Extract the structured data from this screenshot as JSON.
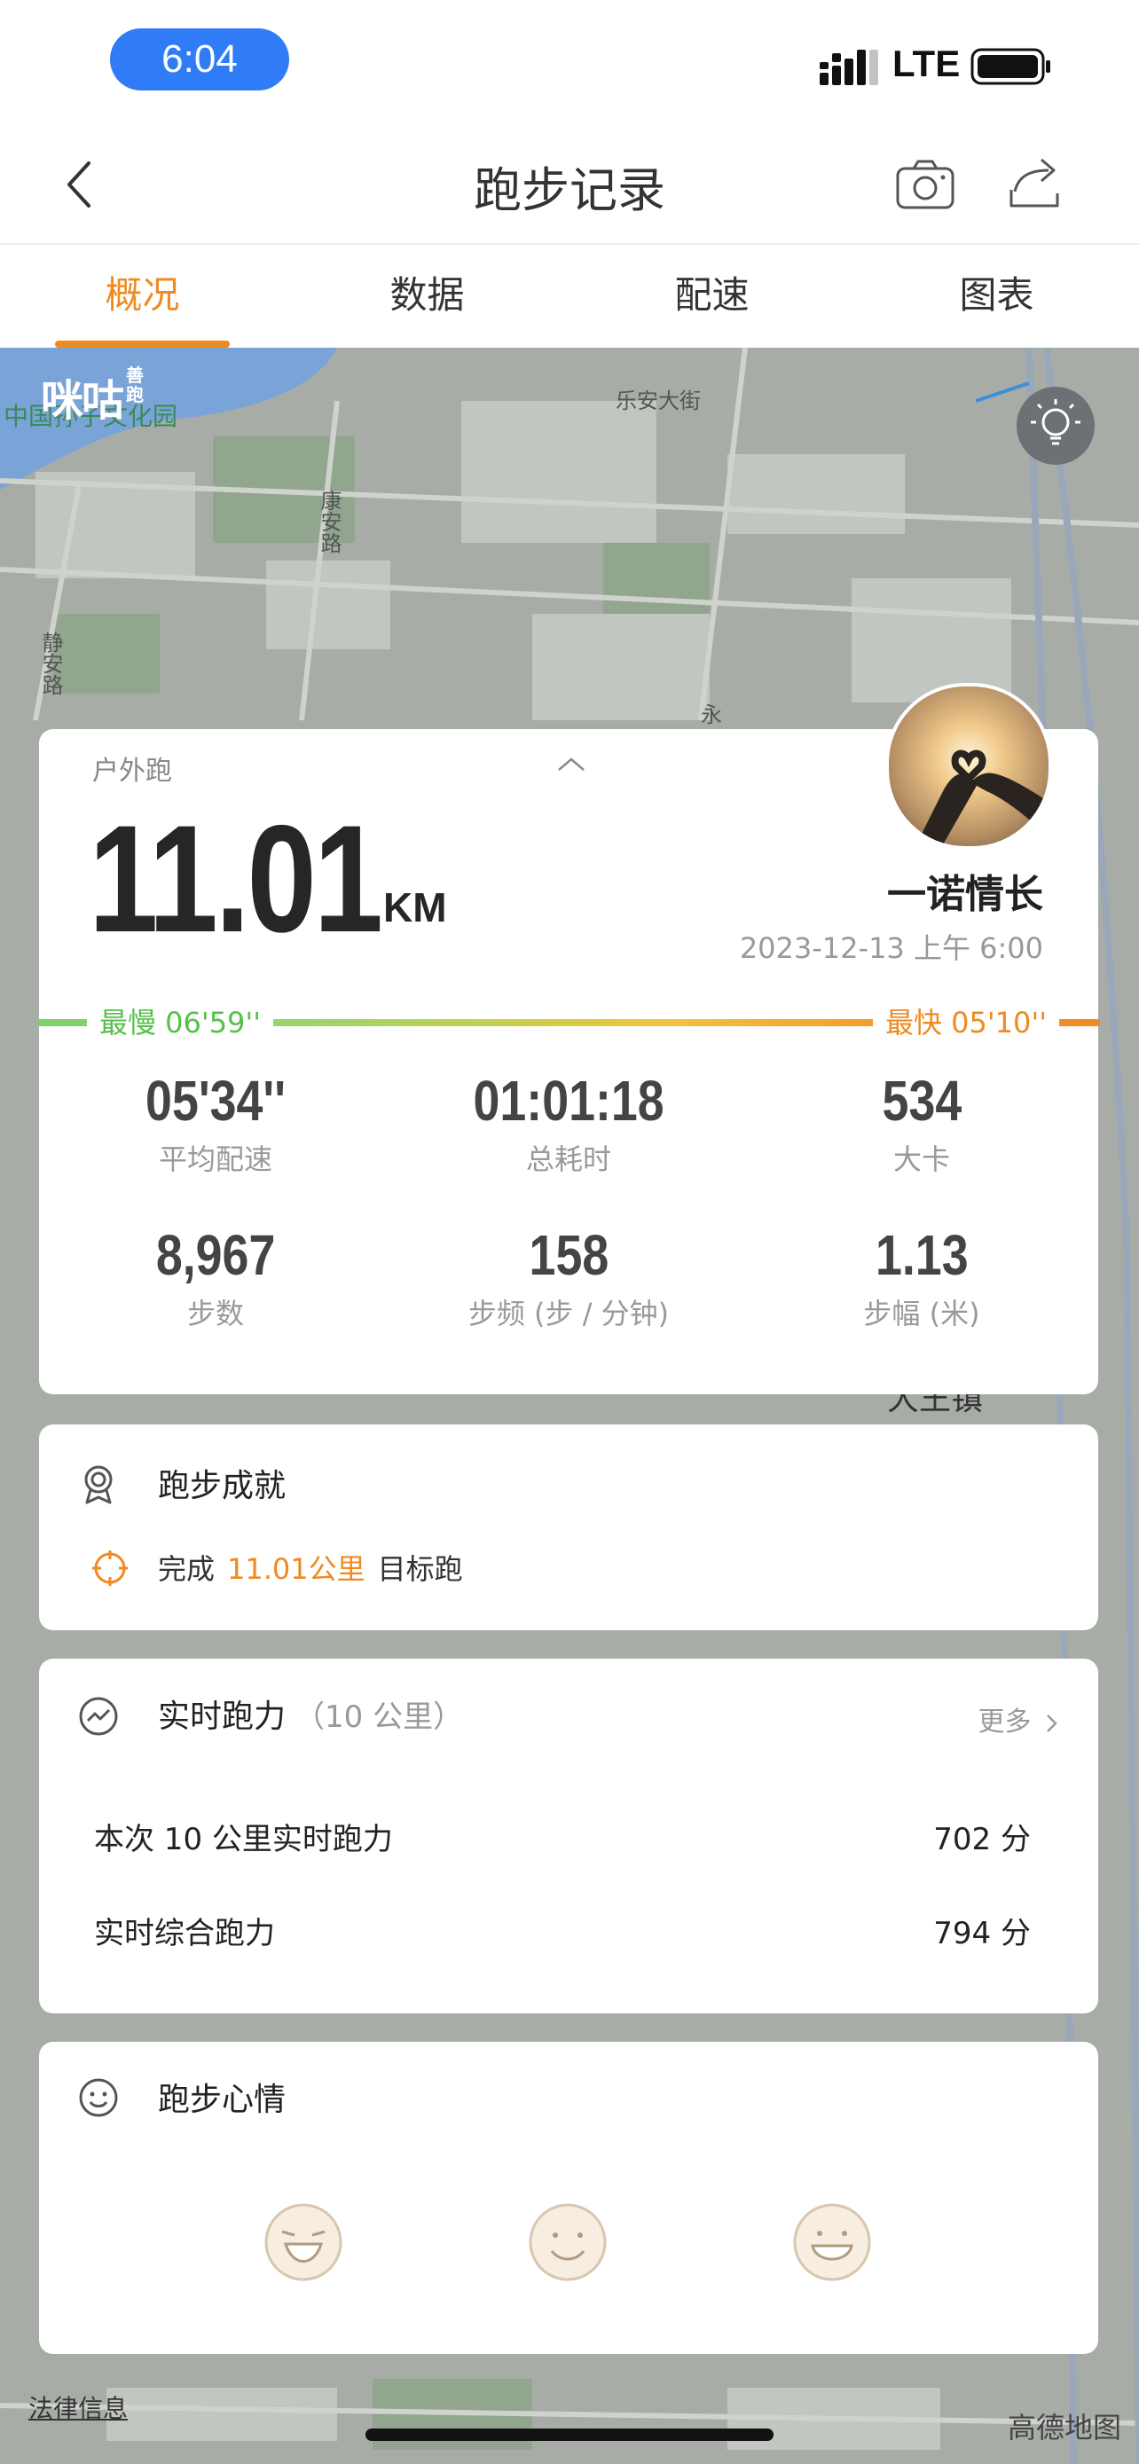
{
  "status_bar": {
    "time": "6:04",
    "network": "LTE"
  },
  "nav": {
    "title": "跑步记录"
  },
  "tabs": [
    {
      "label": "概况",
      "active": true
    },
    {
      "label": "数据",
      "active": false
    },
    {
      "label": "配速",
      "active": false
    },
    {
      "label": "图表",
      "active": false
    }
  ],
  "map": {
    "logo": "咪咕",
    "logo_sub": "善跑",
    "poi": "中国孙子文化园",
    "roads": [
      "乐安大街",
      "康安路",
      "静安路",
      "永",
      "大王镇"
    ],
    "legal": "法律信息",
    "provider": "高德地图"
  },
  "summary": {
    "run_type": "户外跑",
    "distance": "11.01",
    "distance_unit": "KM",
    "username": "一诺情长",
    "datetime": "2023-12-13 上午 6:00",
    "slowest_label": "最慢  06'59''",
    "fastest_label": "最快  05'10''",
    "stats": [
      {
        "value": "05'34''",
        "label": "平均配速"
      },
      {
        "value": "01:01:18",
        "label": "总耗时"
      },
      {
        "value": "534",
        "label": "大卡"
      },
      {
        "value": "8,967",
        "label": "步数"
      },
      {
        "value": "158",
        "label": "步频 (步 / 分钟)"
      },
      {
        "value": "1.13",
        "label": "步幅 (米)"
      }
    ]
  },
  "achievement": {
    "title": "跑步成就",
    "prefix": "完成",
    "highlight": "11.01公里",
    "suffix": "目标跑"
  },
  "power": {
    "title": "实时跑力",
    "subtitle": "（10 公里）",
    "more": "更多",
    "rows": [
      {
        "label": "本次 10 公里实时跑力",
        "value": "702 分"
      },
      {
        "label": "实时综合跑力",
        "value": "794 分"
      }
    ]
  },
  "mood": {
    "title": "跑步心情"
  },
  "colors": {
    "accent": "#ef8a20",
    "slow": "#57c04b",
    "status_pill": "#2f7cf6"
  }
}
